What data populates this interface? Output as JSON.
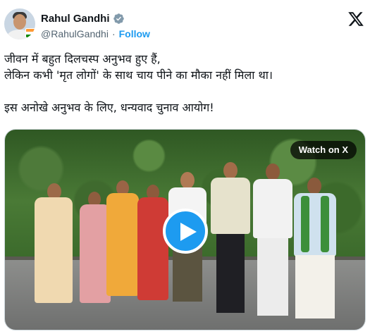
{
  "author": {
    "display_name": "Rahul Gandhi",
    "handle": "@RahulGandhi",
    "separator": "·",
    "follow_label": "Follow",
    "verified_badge_icon": "verified-gray-icon",
    "avatar_icon": "profile-avatar"
  },
  "platform_logo_icon": "x-logo-icon",
  "tweet": {
    "line1": "जीवन में बहुत दिलचस्प अनुभव हुए हैं,",
    "line2": "लेकिन कभी 'मृत लोगों' के साथ चाय पीने का मौका नहीं मिला था।",
    "line3": "इस अनोखे अनुभव के लिए, धन्यवाद चुनाव आयोग!"
  },
  "media": {
    "watch_label": "Watch on X",
    "play_icon": "play-icon",
    "type": "video"
  },
  "colors": {
    "accent": "#1d9bf0",
    "text": "#0f1419",
    "secondary_text": "#536471",
    "verified_badge": "#829aab"
  }
}
